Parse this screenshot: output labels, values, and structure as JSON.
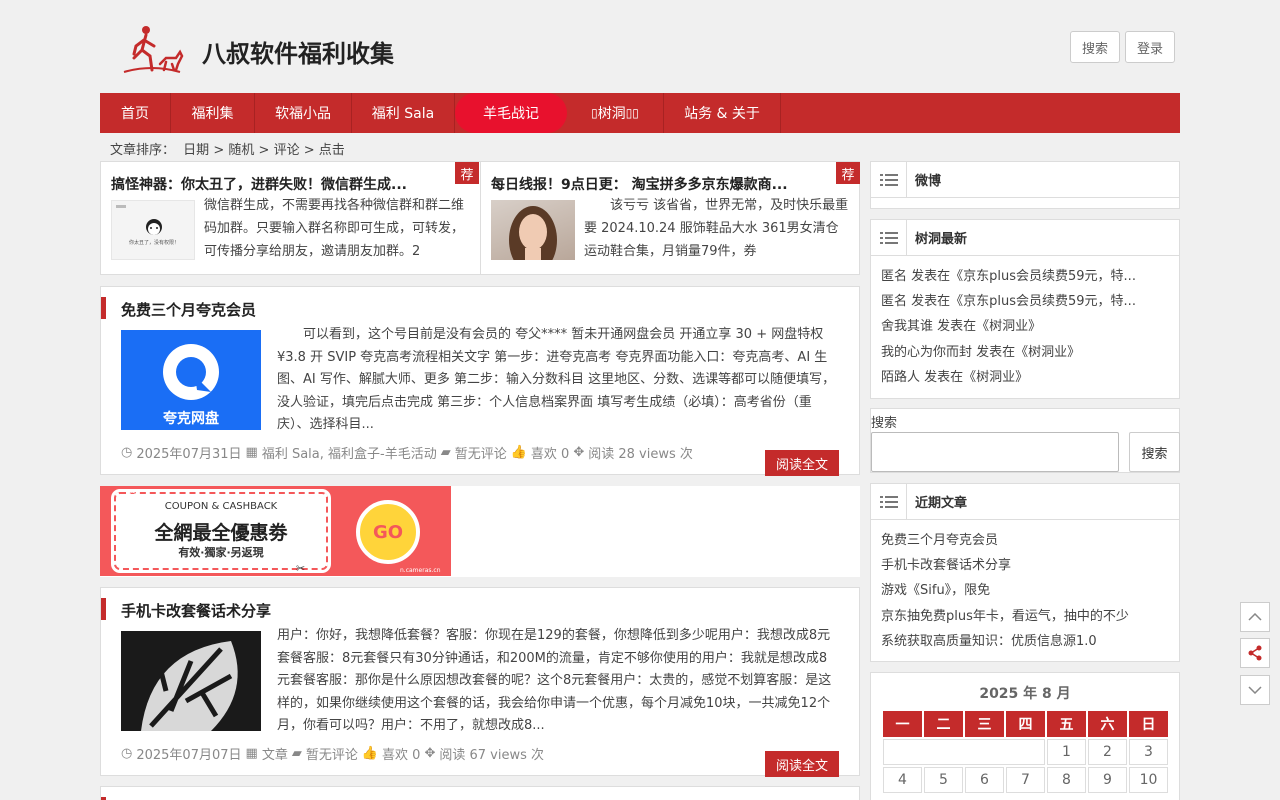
{
  "header": {
    "site_title": "八叔软件福利收集",
    "search_button": "搜索",
    "login_button": "登录"
  },
  "nav": {
    "items": [
      {
        "label": "首页"
      },
      {
        "label": "福利集"
      },
      {
        "label": "软福小品"
      },
      {
        "label": "福利 Sala"
      },
      {
        "label": "羊毛战记"
      },
      {
        "label": "树洞"
      },
      {
        "label": "站务 & 关于"
      }
    ]
  },
  "sortbar": {
    "label": "文章排序：",
    "options": [
      "日期",
      "随机",
      "评论",
      "点击"
    ],
    "separator": ">"
  },
  "recommended": [
    {
      "tag": "荐",
      "title": "搞怪神器：你太丑了，进群失败！微信群生成...",
      "excerpt": "微信群生成，不需要再找各种微信群和群二维码加群。只要输入群名称即可生成，可转发，可传播分享给朋友，邀请朋友加群。2",
      "thumb_caption": "你太丑了，没有权限！"
    },
    {
      "tag": "荐",
      "title": "每日线报！9点日更： 淘宝拼多多京东爆款商...",
      "excerpt": "该亏亏 该省省，世界无常，及时快乐最重要 2024.10.24 服饰鞋品大水 361男女清仓运动鞋合集，月销量79件，券"
    }
  ],
  "posts": [
    {
      "title": "免费三个月夸克会员",
      "excerpt": "可以看到，这个号目前是没有会员的 夸父**** 暂未开通网盘会员 开通立享 30 + 网盘特权 ¥3.8 开 SVIP 夸克高考流程相关文字 第一步：进夸克高考 夸克界面功能入口：夸克高考、AI 生图、AI 写作、解腻大师、更多 第二步：输入分数科目 这里地区、分数、选课等都可以随便填写，没人验证，填完后点击完成 第三步：个人信息档案界面 填写考生成绩（必填）：高考省份（重庆）、选择科目...",
      "thumb_text": "夸克网盘",
      "date": "2025年07月31日",
      "category": "福利 Sala, 福利盒子-羊毛活动",
      "comments": "暂无评论",
      "likes": "喜欢 0",
      "views": "阅读 28 views 次",
      "readmore": "阅读全文"
    },
    {
      "title": "手机卡改套餐话术分享",
      "excerpt": "用户：你好，我想降低套餐？客服：你现在是129的套餐，你想降低到多少呢用户：我想改成8元套餐客服：8元套餐只有30分钟通话，和200M的流量，肯定不够你使用的用户：我就是想改成8元套餐客服：那你是什么原因想改套餐的呢？这个8元套餐用户：太贵的，感觉不划算客服：是这样的，如果你继续使用这个套餐的话，我会给你申请一个优惠，每个月减免10块，一共减免12个月，你看可以吗？用户：不用了，就想改成8...",
      "date": "2025年07月07日",
      "category": "文章",
      "comments": "暂无评论",
      "likes": "喜欢 0",
      "views": "阅读 67 views 次",
      "readmore": "阅读全文"
    }
  ],
  "banner": {
    "top": "COUPON & CASHBACK",
    "main": "全網最全優惠劵",
    "sub": "有效·獨家·另返現",
    "go": "GO",
    "url": "n.cameras.cn"
  },
  "sidebar": {
    "weibo_title": "微博",
    "treehole_title": "树洞最新",
    "treehole_items": [
      "匿名 发表在《京东plus会员续费59元，特...",
      "匿名 发表在《京东plus会员续费59元，特...",
      "舍我其谁 发表在《树洞业》",
      "我的心为你而封 发表在《树洞业》",
      "陌路人 发表在《树洞业》"
    ],
    "search_label": "搜索",
    "search_button": "搜索",
    "search_value": "",
    "recent_title": "近期文章",
    "recent_items": [
      "免费三个月夸克会员",
      "手机卡改套餐话术分享",
      "游戏《Sifu》，限免",
      "京东抽免费plus年卡，看运气，抽中的不少",
      "系统获取高质量知识：优质信息源1.0"
    ],
    "calendar_title": "2025 年 8 月",
    "weekdays": [
      "一",
      "二",
      "三",
      "四",
      "五",
      "六",
      "日"
    ],
    "days": [
      "",
      "",
      "",
      "",
      "1",
      "2",
      "3",
      "4",
      "5",
      "6",
      "7",
      "8",
      "9",
      "10"
    ]
  },
  "colors": {
    "brand_red": "#c42b2b",
    "nav_active": "#e8112d"
  }
}
